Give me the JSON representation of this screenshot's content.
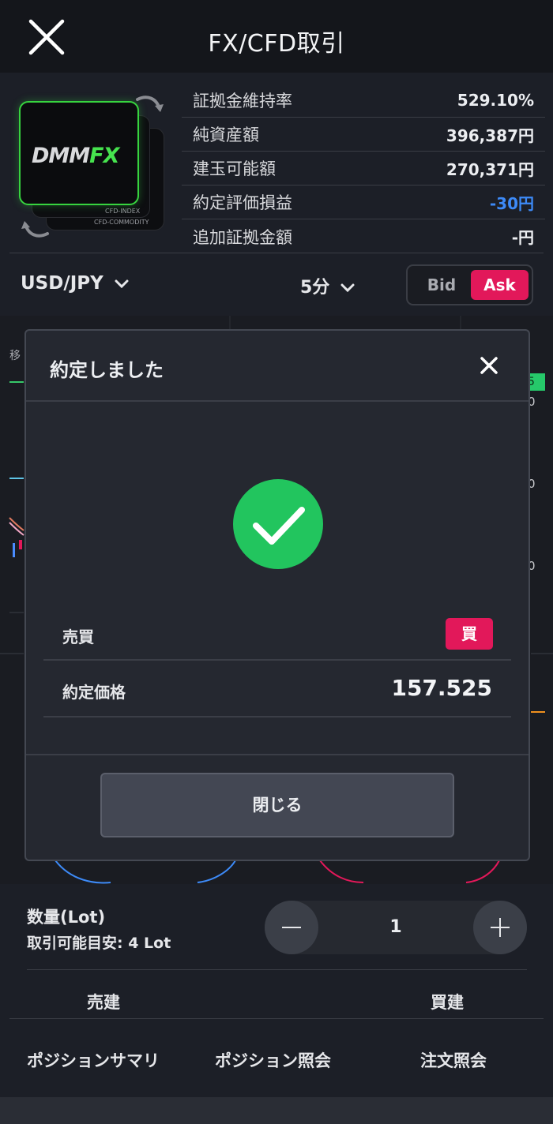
{
  "header": {
    "title": "FX/CFD取引"
  },
  "logo": {
    "brand_left": "DMM",
    "brand_right": "FX",
    "label_index": "CFD-INDEX",
    "label_commodity": "CFD-COMMODITY"
  },
  "account": {
    "rows": [
      {
        "label": "証拠金維持率",
        "value": "529.10%"
      },
      {
        "label": "純資産額",
        "value": "396,387円"
      },
      {
        "label": "建玉可能額",
        "value": "270,371円"
      },
      {
        "label": "約定評価損益",
        "value": "-30円"
      },
      {
        "label": "追加証拠金額",
        "value": "-円"
      }
    ]
  },
  "controls": {
    "pair": "USD/JPY",
    "timeframe": "5分",
    "bid_label": "Bid",
    "ask_label": "Ask",
    "active_side": "Ask"
  },
  "chart_peek": {
    "left_text": "移",
    "right_badge": "5",
    "right_ticks": [
      "0",
      "0",
      "0"
    ]
  },
  "quantity": {
    "label": "数量(Lot)",
    "hint": "取引可能目安: 4 Lot",
    "value": "1"
  },
  "trade": {
    "sell_label": "売建",
    "buy_label": "買建"
  },
  "tabs": [
    "ポジションサマリ",
    "ポジション照会",
    "注文照会"
  ],
  "modal": {
    "title": "約定しました",
    "side_label": "売買",
    "side_value": "買",
    "price_label": "約定価格",
    "price_value": "157.525",
    "close_label": "閉じる"
  },
  "colors": {
    "accent_pink": "#e2185a",
    "success_green": "#22c55e",
    "negative_blue": "#3d8af7",
    "logo_green": "#46e34e"
  }
}
